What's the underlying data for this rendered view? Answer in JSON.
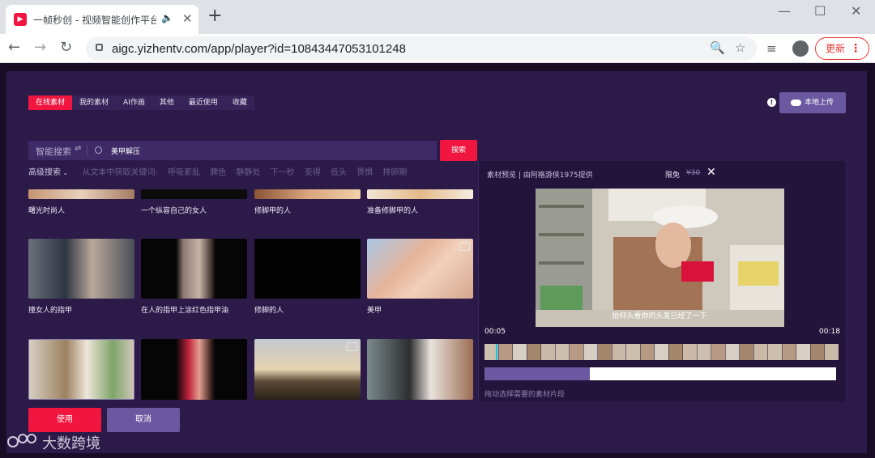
{
  "browser": {
    "tab_title": "一帧秒创 - 视频智能创作平台",
    "url": "aigc.yizhentv.com/app/player?id=10843447053101248",
    "update_label": "更新"
  },
  "app": {
    "category_tabs": [
      "在线素材",
      "我的素材",
      "AI作画",
      "其他",
      "最近使用",
      "收藏"
    ],
    "upload_label": "本地上传",
    "search": {
      "type_label": "智能搜索",
      "query": "美甲解压",
      "button_label": "搜索"
    },
    "advanced": {
      "label": "高级搜索",
      "hint": "从文本中获取关键词:",
      "keywords": [
        "呼吸紊乱",
        "脾色",
        "静静处",
        "下一秒",
        "变得",
        "低头",
        "畏惧",
        "排卵期"
      ]
    },
    "grid": {
      "row1_labels": [
        "曙光时尚人",
        "一个纵容自己的女人",
        "修脚甲的人",
        "准备修脚甲的人"
      ],
      "row2_labels": [
        "撞女人的指甲",
        "在人的指甲上涂红色指甲油",
        "修脚的人",
        "美甲"
      ]
    },
    "preview": {
      "header": "素材预览 | 由阿格游侠1975提供",
      "free_label": "限免",
      "original_price": "¥30",
      "subtitle": "抬仰头看你的头发已经了一下",
      "time_start": "00:05",
      "time_end": "00:18",
      "selection_fraction": 0.3,
      "hint": "拖动选择需要的素材片段"
    },
    "use_label": "使用",
    "cancel_label": "取消"
  },
  "watermark": {
    "text": "大数跨境"
  }
}
